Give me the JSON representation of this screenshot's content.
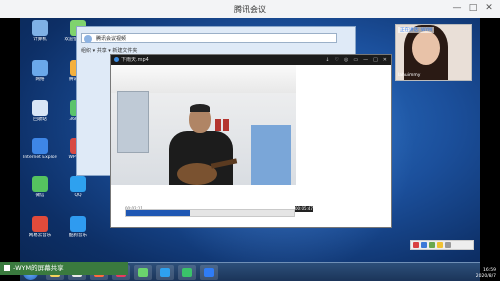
{
  "app": {
    "title": "腾讯会议"
  },
  "share": {
    "indicator_label": "-WYM的屏幕共享"
  },
  "desktop": {
    "icons": [
      {
        "label": "计算机",
        "color": "#7fb1e6"
      },
      {
        "label": "欢迎使用工具",
        "color": "#7fd36d"
      },
      {
        "label": "网络",
        "color": "#6aa8ea"
      },
      {
        "label": "腾讯视频",
        "color": "#f4b03e"
      },
      {
        "label": "回收站",
        "color": "#d9e6f6"
      },
      {
        "label": "360安全",
        "color": "#5bc46c"
      },
      {
        "label": "Internet Explorer",
        "color": "#3e86e6"
      },
      {
        "label": "WPS文字",
        "color": "#d84a44"
      },
      {
        "label": "微信",
        "color": "#55c35f"
      },
      {
        "label": "QQ",
        "color": "#2ea1ef"
      },
      {
        "label": "网易云音乐",
        "color": "#e04b3b"
      },
      {
        "label": "酷狗音乐",
        "color": "#2f9bf0"
      }
    ]
  },
  "explorer": {
    "address": "腾讯会议视频",
    "toolbar": "组织 ▾   共享 ▾   新建文件夹"
  },
  "player": {
    "filename": "下雨天.mp4",
    "time_elapsed": "00:02:11",
    "time_total": "00:05:47",
    "progress": 0.38,
    "controls": [
      "↓",
      "♡",
      "◎",
      "▭",
      "—",
      "□",
      "✕"
    ]
  },
  "participant": {
    "speaking_label": "正在讲话: WYM",
    "user": "lahuimmy"
  },
  "taskbar": {
    "apps": [
      {
        "color": "#f4d35e"
      },
      {
        "color": "#e9e9e9"
      },
      {
        "color": "#ff6a3d"
      },
      {
        "color": "#e93b5f"
      },
      {
        "color": "#6bd36d"
      },
      {
        "color": "#2ea1ef"
      },
      {
        "color": "#3ac26a"
      },
      {
        "color": "#2f7cf6"
      }
    ],
    "time": "16:59",
    "date": "2020/8/7"
  }
}
